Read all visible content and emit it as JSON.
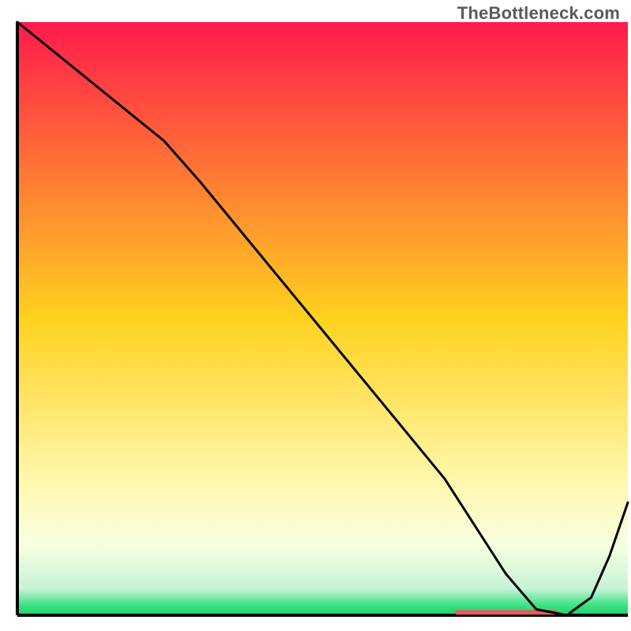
{
  "watermark": {
    "text": "TheBottleneck.com"
  },
  "chart_data": {
    "type": "line",
    "title": "",
    "xlabel": "",
    "ylabel": "",
    "xlim": [
      0,
      100
    ],
    "ylim": [
      0,
      100
    ],
    "grid": false,
    "legend": false,
    "background_gradient": {
      "direction": "vertical",
      "stops": [
        {
          "offset": 0.0,
          "color": "#ff1a4b"
        },
        {
          "offset": 0.5,
          "color": "#ffd21f"
        },
        {
          "offset": 0.78,
          "color": "#fff8b0"
        },
        {
          "offset": 0.88,
          "color": "#f8ffe0"
        },
        {
          "offset": 0.955,
          "color": "#c7f3d6"
        },
        {
          "offset": 0.985,
          "color": "#35e07f"
        },
        {
          "offset": 1.0,
          "color": "#1fd36e"
        }
      ]
    },
    "series": [
      {
        "name": "curve",
        "color": "#000000",
        "width": 3,
        "x": [
          0,
          6,
          12,
          18,
          24,
          30,
          38,
          46,
          54,
          62,
          70,
          75,
          80,
          85,
          90,
          94,
          97,
          100
        ],
        "y": [
          100,
          95,
          90,
          85,
          80,
          73,
          63,
          53,
          43,
          33,
          23,
          15,
          7,
          1,
          0,
          3,
          10,
          19
        ],
        "_note": "y is percentage height above bottom axis; x is percentage across. Curve descends steeply from top-left, touches zero around x≈85, then rises to ~19 at right edge."
      }
    ],
    "marker": {
      "name": "baseline-segment",
      "color": "#e0605a",
      "x_start": 72,
      "x_end": 88,
      "y": 0.5,
      "thickness": 6,
      "_note": "short red horizontal bar sitting on the x-axis under the trough"
    },
    "axes": {
      "left": {
        "color": "#000000",
        "width": 4
      },
      "bottom": {
        "color": "#000000",
        "width": 4
      }
    }
  }
}
